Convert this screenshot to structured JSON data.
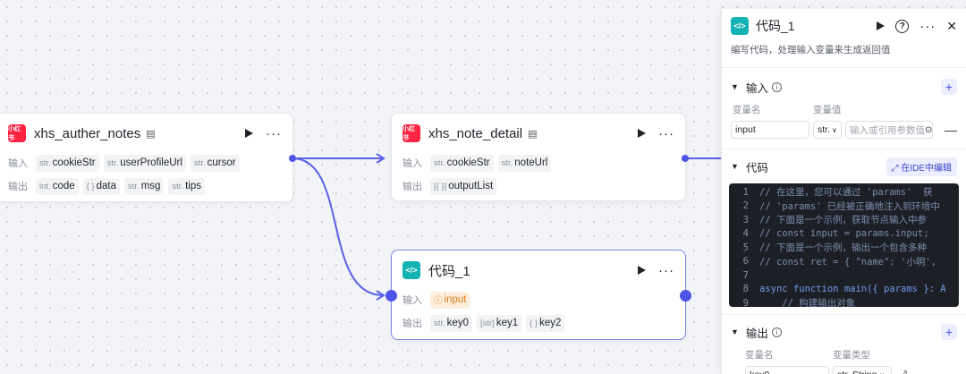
{
  "nodes": {
    "auther": {
      "icon_text": "小红书",
      "title": "xhs_auther_notes",
      "input_label": "输入",
      "output_label": "输出",
      "inputs": [
        {
          "type": "str.",
          "name": "cookieStr"
        },
        {
          "type": "str.",
          "name": "userProfileUrl"
        },
        {
          "type": "str.",
          "name": "cursor"
        }
      ],
      "outputs": [
        {
          "type": "int.",
          "name": "code"
        },
        {
          "type": "{ }",
          "name": "data"
        },
        {
          "type": "str.",
          "name": "msg"
        },
        {
          "type": "str.",
          "name": "tips"
        }
      ]
    },
    "detail": {
      "icon_text": "小红书",
      "title": "xhs_note_detail",
      "input_label": "输入",
      "output_label": "输出",
      "inputs": [
        {
          "type": "str.",
          "name": "cookieStr"
        },
        {
          "type": "str.",
          "name": "noteUrl"
        }
      ],
      "outputs": [
        {
          "type": "[{ }]",
          "name": "outputList"
        }
      ]
    },
    "code": {
      "icon_text": "</>",
      "title": "代码_1",
      "input_label": "输入",
      "output_label": "输出",
      "inputs": [
        {
          "type": "ⓘ",
          "name": "input"
        }
      ],
      "outputs": [
        {
          "type": "str.",
          "name": "key0"
        },
        {
          "type": "[str]",
          "name": "key1"
        },
        {
          "type": "{ }",
          "name": "key2"
        }
      ]
    }
  },
  "panel": {
    "title": "代码_1",
    "icon_text": "</>",
    "description": "编写代码，处理输入变量来生成返回值",
    "input_section": {
      "label": "输入",
      "col_name": "变量名",
      "col_value": "变量值",
      "row": {
        "name": "input",
        "type": "str.",
        "placeholder": "输入或引用参数值"
      }
    },
    "code_section": {
      "label": "代码",
      "ide_button": "在IDE中编辑",
      "lines": [
        {
          "n": "1",
          "text": "// 在这里，您可以通过 'params'  获"
        },
        {
          "n": "2",
          "text": "// 'params' 已经被正确地注入到环境中"
        },
        {
          "n": "3",
          "text": "// 下面是一个示例，获取节点输入中参"
        },
        {
          "n": "4",
          "text": "// const input = params.input;"
        },
        {
          "n": "5",
          "text": "// 下面是一个示例，输出一个包含多种"
        },
        {
          "n": "6",
          "text": "// const ret = { \"name\": '小明',"
        },
        {
          "n": "7",
          "text": ""
        },
        {
          "n": "8",
          "text": "async function main({ params }: A"
        },
        {
          "n": "9",
          "text": "    // 构建输出对象"
        }
      ]
    },
    "output_section": {
      "label": "输出",
      "col_name": "变量名",
      "col_type": "变量类型",
      "row": {
        "name": "key0",
        "type": "str. String"
      }
    }
  },
  "colors": {
    "accent": "#4e54e5",
    "edge": "#5a60e8",
    "xhs_red": "#ff2442",
    "code_teal": "#14b2b2"
  }
}
